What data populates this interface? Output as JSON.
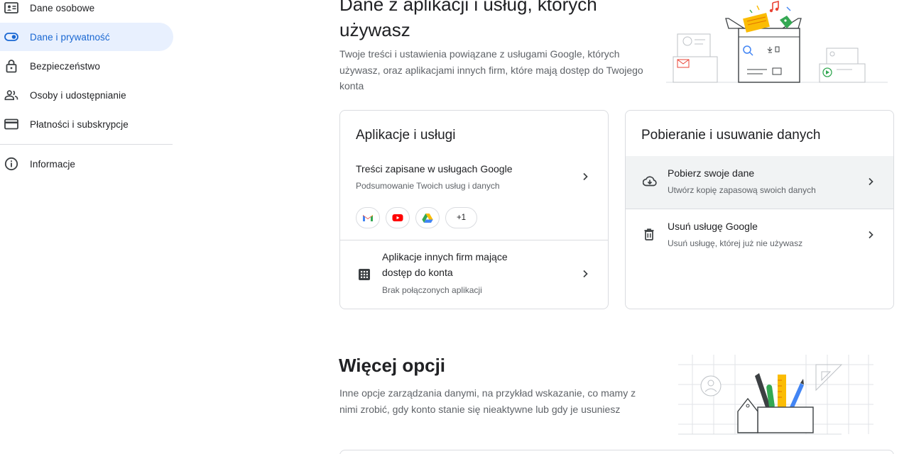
{
  "sidebar": {
    "items": [
      {
        "label": "Dane osobowe",
        "icon": "id-card-icon"
      },
      {
        "label": "Dane i prywatność",
        "icon": "toggle-icon"
      },
      {
        "label": "Bezpieczeństwo",
        "icon": "lock-icon"
      },
      {
        "label": "Osoby i udostępnianie",
        "icon": "people-icon"
      },
      {
        "label": "Płatności i subskrypcje",
        "icon": "credit-card-icon"
      },
      {
        "label": "Informacje",
        "icon": "info-icon"
      }
    ],
    "active_index": 1
  },
  "hero": {
    "title": "Dane z aplikacji i usług, których używasz",
    "description": "Twoje treści i ustawienia powiązane z usługami Google, których używasz, oraz aplikacjami innych firm, które mają dostęp do Twojego konta"
  },
  "apps_card": {
    "title": "Aplikacje i usługi",
    "saved_row": {
      "title": "Treści zapisane w usługach Google",
      "subtitle": "Podsumowanie Twoich usług i danych"
    },
    "chips": [
      "gmail-icon",
      "youtube-icon",
      "drive-icon"
    ],
    "chips_more": "+1",
    "third_party_row": {
      "title": "Aplikacje innych firm mające dostęp do konta",
      "subtitle": "Brak połączonych aplikacji"
    }
  },
  "download_card": {
    "title": "Pobieranie i usuwanie danych",
    "download_row": {
      "title": "Pobierz swoje dane",
      "subtitle": "Utwórz kopię zapasową swoich danych"
    },
    "delete_row": {
      "title": "Usuń usługę Google",
      "subtitle": "Usuń usługę, której już nie używasz"
    }
  },
  "more_options": {
    "title": "Więcej opcji",
    "description": "Inne opcje zarządzania danymi, na przykład wskazanie, co mamy z nimi zrobić, gdy konto stanie się nieaktywne lub gdy je usuniesz"
  },
  "colors": {
    "accent": "#1967d2",
    "active_bg": "#e8f0fe",
    "border": "#dadce0",
    "text_secondary": "#5f6368",
    "highlight_row": "#f1f3f4"
  }
}
